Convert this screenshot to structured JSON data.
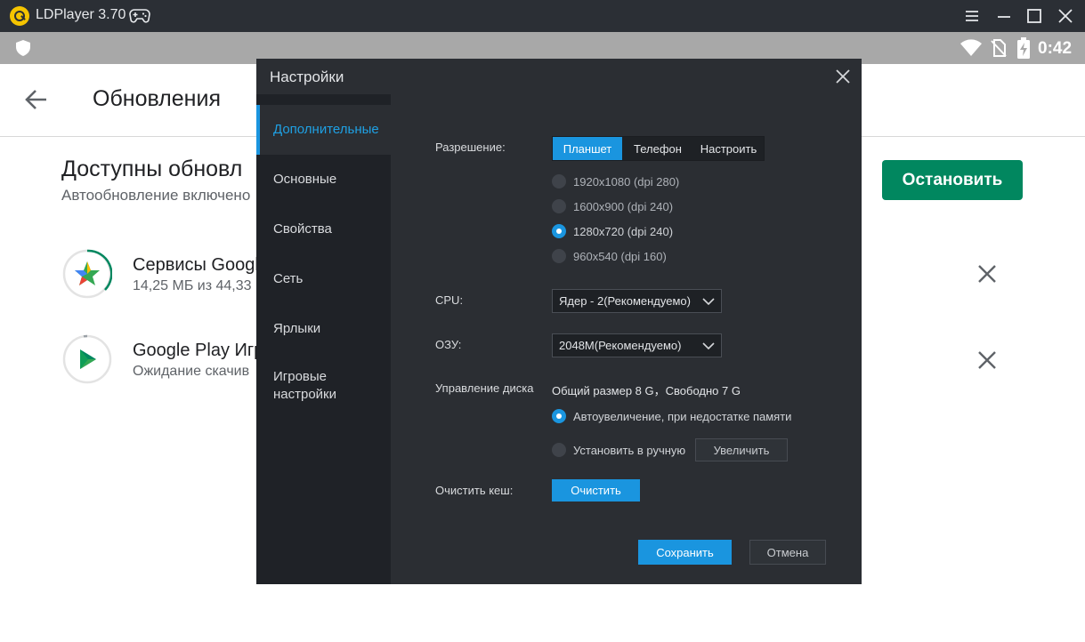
{
  "window": {
    "title": "LDPlayer 3.70"
  },
  "status_bar": {
    "time": "0:42"
  },
  "app_page": {
    "page_title": "Обновления",
    "section_title": "Доступны обновл",
    "section_subtitle": "Автообновление включено",
    "stop_button": "Остановить",
    "apps": [
      {
        "name": "Сервисы Googl",
        "status": "14,25 МБ из 44,33",
        "progress_percent": 32
      },
      {
        "name": "Google Play Игр",
        "status": "Ожидание скачив",
        "progress_percent": 0
      }
    ]
  },
  "dialog": {
    "title": "Настройки",
    "sidebar": [
      {
        "label": "Дополнительные",
        "active": true
      },
      {
        "label": "Основные",
        "active": false
      },
      {
        "label": "Свойства",
        "active": false
      },
      {
        "label": "Сеть",
        "active": false
      },
      {
        "label": "Ярлыки",
        "active": false
      },
      {
        "label": "Игровые настройки",
        "active": false
      }
    ],
    "resolution": {
      "label": "Разрешение:",
      "tabs": [
        "Планшет",
        "Телефон",
        "Настроить"
      ],
      "active_tab": "Планшет",
      "options": [
        "1920x1080  (dpi 280)",
        "1600x900  (dpi 240)",
        "1280x720  (dpi 240)",
        "960x540  (dpi 160)"
      ],
      "selected_option": "1280x720  (dpi 240)"
    },
    "cpu": {
      "label": "CPU:",
      "value": "Ядер - 2(Рекомендуемо)"
    },
    "ram": {
      "label": "ОЗУ:",
      "value": "2048M(Рекомендуемо)"
    },
    "disk": {
      "label": "Управление диска",
      "info": "Общий размер 8 G，Свободно 7 G",
      "auto_option": "Автоувеличение, при недостатке памяти",
      "manual_option": "Установить в ручную",
      "increase_button": "Увеличить",
      "selected": "auto"
    },
    "cache": {
      "label": "Очистить кеш:",
      "button": "Очистить"
    },
    "save_button": "Сохранить",
    "cancel_button": "Отмена"
  },
  "colors": {
    "accent_blue": "#1a95df",
    "install_green": "#01875f",
    "dialog_bg": "#2b2e33",
    "sidebar_bg": "#1f2227",
    "titlebar_bg": "#2b2f35"
  }
}
